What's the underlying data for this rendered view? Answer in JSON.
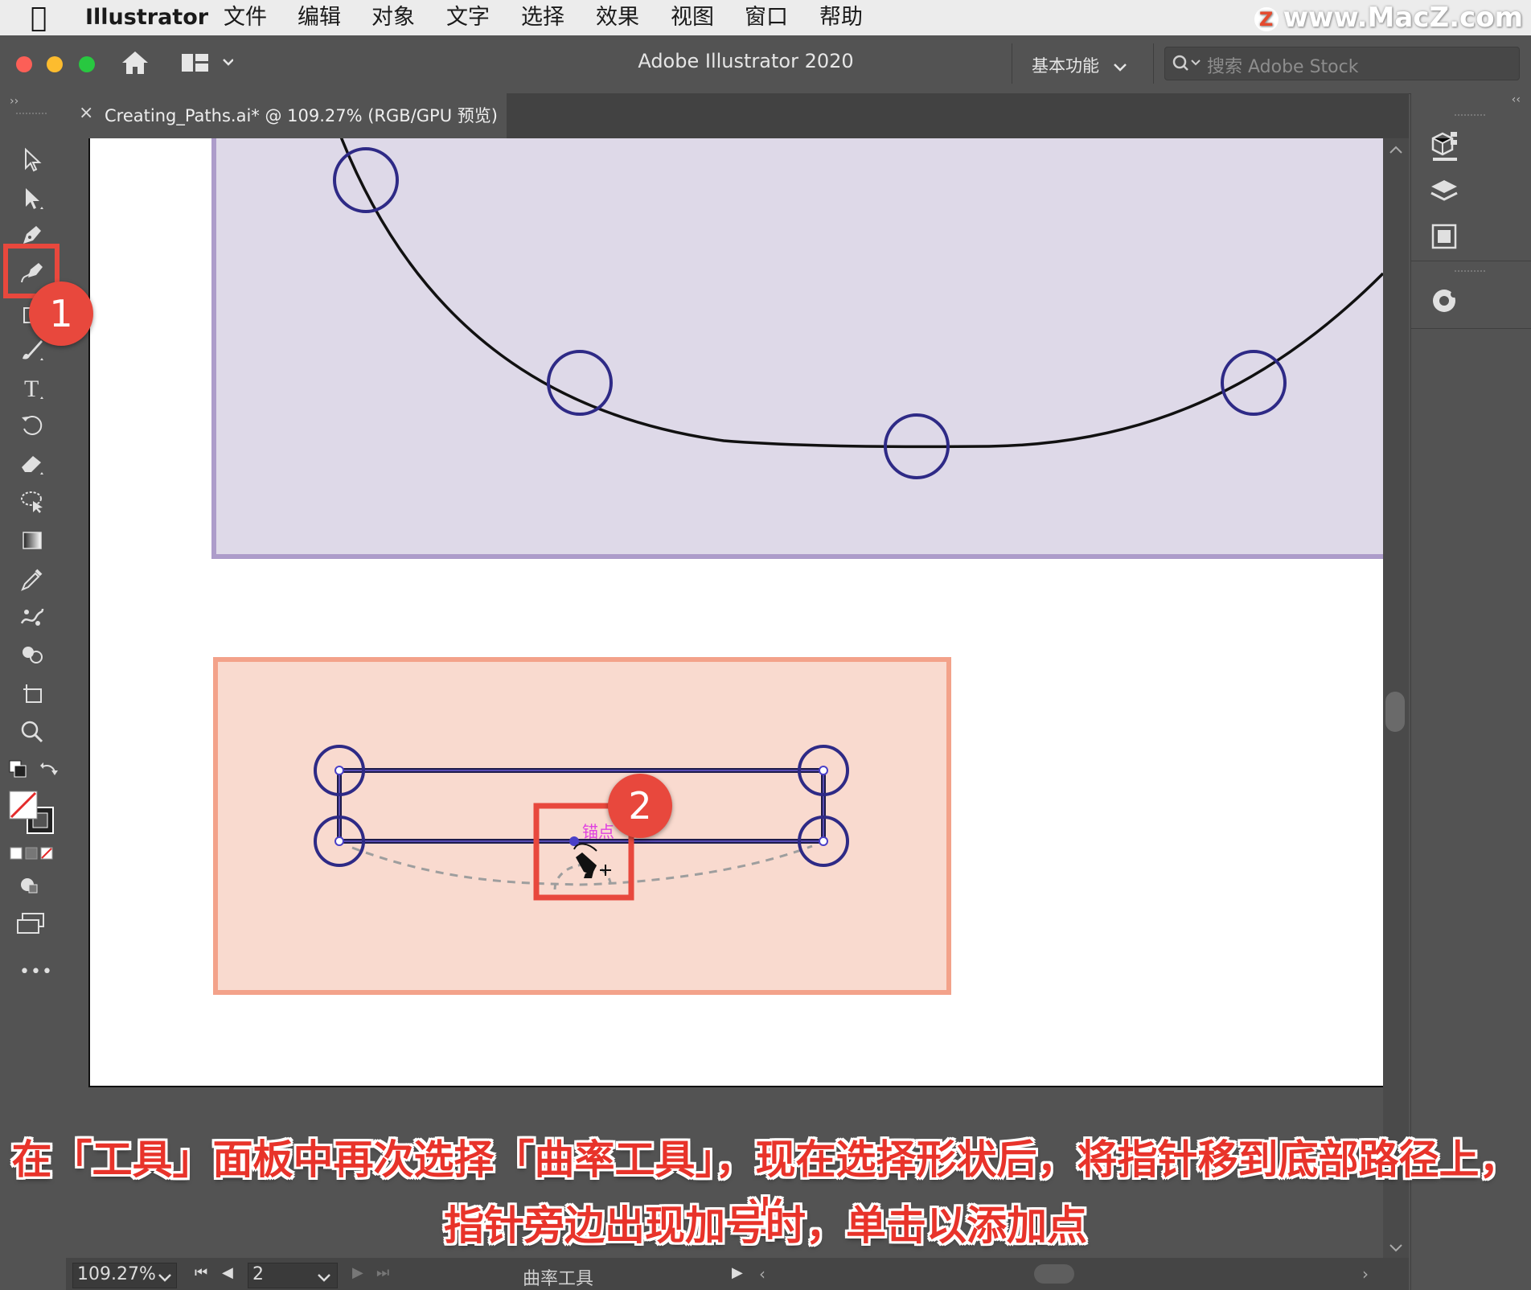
{
  "menubar": {
    "app": "Illustrator",
    "items": [
      "文件",
      "编辑",
      "对象",
      "文字",
      "选择",
      "效果",
      "视图",
      "窗口",
      "帮助"
    ],
    "watermark": "www.MacZ.com",
    "watermark_logo": "Z"
  },
  "appbar": {
    "title": "Adobe Illustrator 2020",
    "workspace": "基本功能",
    "search_placeholder": "搜索 Adobe Stock"
  },
  "document_tab": {
    "close": "×",
    "title": "Creating_Paths.ai* @ 109.27% (RGB/GPU 预览)"
  },
  "toolbar": {
    "tools": [
      "selection-tool",
      "direct-selection-tool",
      "pen-tool",
      "curvature-tool",
      "rectangle-tool",
      "paintbrush-tool",
      "type-tool",
      "rotate-tool",
      "eraser-tool",
      "lasso-tool",
      "gradient-tool",
      "eyedropper-tool",
      "puppet-warp-tool",
      "shape-builder-tool",
      "artboard-tool",
      "zoom-tool"
    ],
    "more": "•••"
  },
  "canvas": {
    "anchor_tooltip": "锚点",
    "colors": {
      "purple_box_fill": "#ded9e8",
      "purple_box_stroke": "#ad9cca",
      "salmon_box_fill": "#f9dacf",
      "salmon_box_stroke": "#f3a28a",
      "path_stroke": "#1e1b4b",
      "anchor_circle": "#2e2a86"
    }
  },
  "badges": {
    "step1": "1",
    "step2": "2"
  },
  "statusbar": {
    "zoom": "109.27%",
    "artboard": "2",
    "tool_name": "曲率工具"
  },
  "caption": {
    "line1": "在「工具」面板中再次选择「曲率工具」，现在选择形状后，将指针移到底部路径上，当",
    "line2": "指针旁边出现加号时，单击以添加点"
  }
}
